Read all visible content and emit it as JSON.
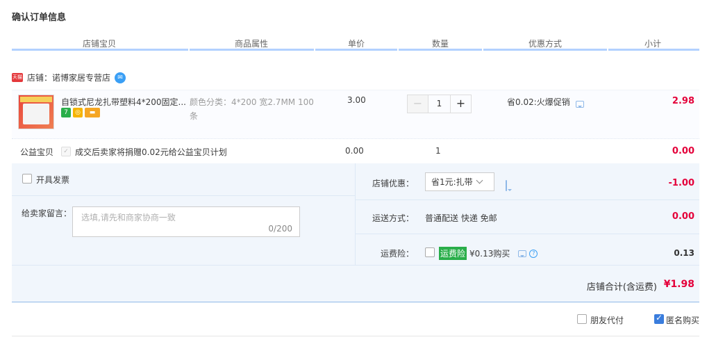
{
  "title": "确认订单信息",
  "columns": [
    "店铺宝贝",
    "商品属性",
    "单价",
    "数量",
    "优惠方式",
    "小计"
  ],
  "shop": {
    "badge": "天猫",
    "label": "店铺：诺博家居专营店"
  },
  "item": {
    "name": "自锁式尼龙扎带塑料4*200固定...",
    "attr": "颜色分类：4*200 宽2.7MM 100条",
    "price": "3.00",
    "qty": "1",
    "qty_minus": "−",
    "qty_plus": "+",
    "promo": "省0.02:火爆促销",
    "subtotal": "2.98",
    "svc_icons": [
      "7",
      "◎",
      "▬"
    ]
  },
  "charity": {
    "label": "公益宝贝",
    "text": "成交后卖家将捐赠0.02元给公益宝贝计划",
    "price": "0.00",
    "qty": "1",
    "subtotal": "0.00"
  },
  "invoice": {
    "label": "开具发票"
  },
  "memo": {
    "label": "给卖家留言：",
    "placeholder": "选填,请先和商家协商一致",
    "count": "0/200"
  },
  "shop_discount": {
    "label": "店铺优惠：",
    "selected": "省1元:扎带",
    "value": "-1.00"
  },
  "shipping": {
    "label": "运送方式：",
    "text": "普通配送 快递 免邮",
    "value": "0.00"
  },
  "insurance": {
    "label": "运费险：",
    "tag": "运费险",
    "text": "¥0.13购买",
    "value": "0.13"
  },
  "total": {
    "label": "店铺合计(含运费)",
    "value": "¥1.98"
  },
  "footer": {
    "friend_pay": "朋友代付",
    "anonymous": "匿名购买"
  },
  "colors": {
    "accent": "#e4003a",
    "panel": "#f1f6fc",
    "header_line": "#b2d1ff"
  }
}
